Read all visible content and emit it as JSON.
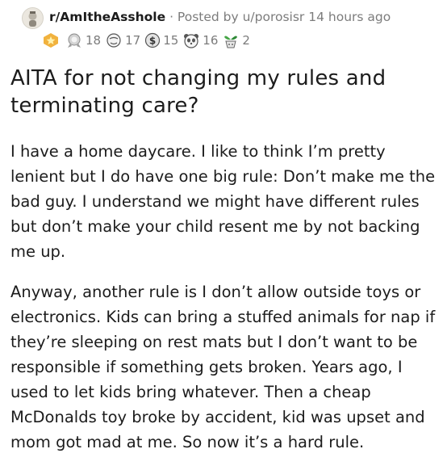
{
  "post": {
    "subreddit": "r/AmItheAsshole",
    "meta_text": " · Posted by u/porosisr 14 hours ago",
    "awards": [
      {
        "icon": "gold-star-award-icon",
        "count": ""
      },
      {
        "icon": "silver-ribbon-award-icon",
        "count": "18"
      },
      {
        "icon": "facepalm-award-icon",
        "count": "17"
      },
      {
        "icon": "coin-award-icon",
        "count": "15"
      },
      {
        "icon": "panda-award-icon",
        "count": "16"
      },
      {
        "icon": "plant-award-icon",
        "count": "2"
      }
    ],
    "title": "AITA for not changing my rules and terminating care?",
    "paragraphs": [
      "I have a home daycare. I like to think I’m pretty lenient but I do have one big rule: Don’t make me the bad guy. I understand we might have different rules but don’t make your child resent me by not backing me up.",
      "Anyway, another rule is I don’t allow outside toys or electronics. Kids can bring a stuffed animals for nap if they’re sleeping on rest mats but I don’t want to be responsible if something gets broken. Years ago, I used to let kids bring whatever. Then a cheap McDonalds toy broke by accident, kid was upset and mom got mad at me. So now it’s a hard rule."
    ]
  }
}
